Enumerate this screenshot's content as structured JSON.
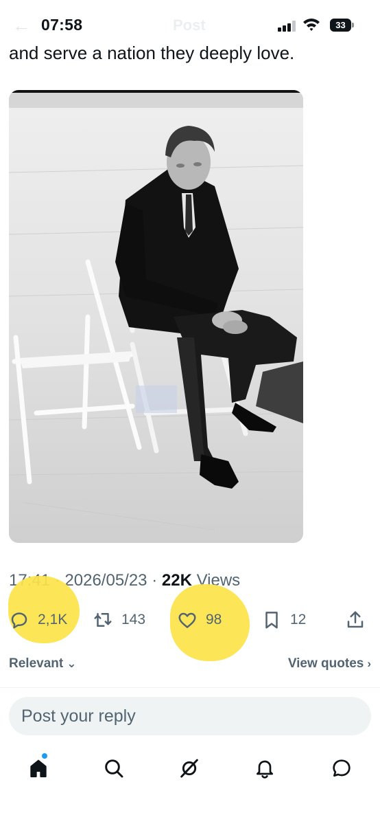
{
  "status_bar": {
    "time": "07:58",
    "battery": "33",
    "header_title": "Post"
  },
  "tweet": {
    "text": "and serve a nation they deeply love.",
    "timestamp_time": "17:41",
    "timestamp_date": "2026/05/23",
    "views_count": "22K",
    "views_label": "Views",
    "separator": "·"
  },
  "actions": {
    "replies": "2,1K",
    "reposts": "143",
    "likes": "98",
    "bookmarks": "12",
    "icons": [
      "reply-icon",
      "repost-icon",
      "like-icon",
      "bookmark-icon",
      "share-icon"
    ]
  },
  "sort": {
    "left_label": "Relevant",
    "right_label": "View quotes"
  },
  "reply": {
    "placeholder": "Post your reply"
  },
  "tab_bar": {
    "items": [
      "home-icon",
      "search-icon",
      "grok-icon",
      "notifications-icon",
      "messages-icon"
    ]
  },
  "colors": {
    "text": "#0f1419",
    "secondary": "#536471",
    "accent": "#1d9bf0",
    "highlight": "#fde34a",
    "input_bg": "#eff3f4"
  }
}
